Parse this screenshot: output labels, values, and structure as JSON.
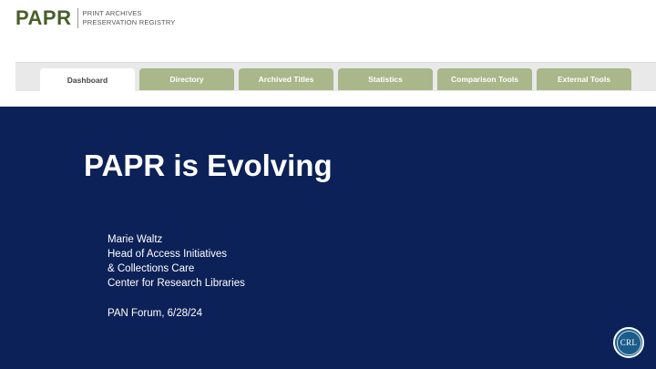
{
  "logo": {
    "wordmark": "PAPR",
    "subtitle_line1": "PRINT ARCHIVES",
    "subtitle_line2": "PRESERVATION REGISTRY"
  },
  "nav": {
    "tabs": [
      {
        "label": "Dashboard",
        "active": true
      },
      {
        "label": "Directory",
        "active": false
      },
      {
        "label": "Archived Titles",
        "active": false
      },
      {
        "label": "Statistics",
        "active": false
      },
      {
        "label": "Comparison Tools",
        "active": false
      },
      {
        "label": "External Tools",
        "active": false
      }
    ]
  },
  "slide": {
    "title": "PAPR is Evolving",
    "presenter": "Marie Waltz",
    "role_line1": "Head of Access Initiatives",
    "role_line2": "& Collections Care",
    "organization": "Center for Research Libraries",
    "event": "PAN Forum, 6/28/24",
    "seal_text": "CRL"
  },
  "colors": {
    "slide_background": "#0c2158",
    "logo_green": "#4a5e2b",
    "tab_inactive": "#a9b78b",
    "tab_active": "#ffffff"
  }
}
